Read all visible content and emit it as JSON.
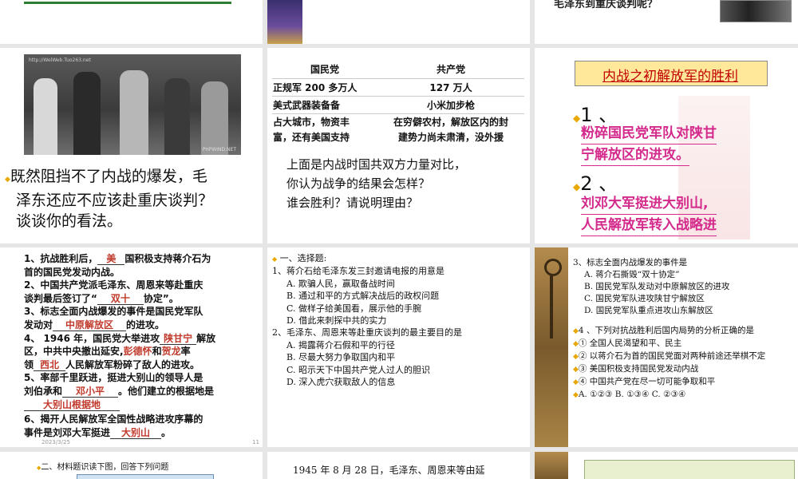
{
  "slide1": {
    "text": "毛泽东到重庆谈判呢？"
  },
  "slide4": {
    "watermark_top": "http://WelWeb.Tuo263.net",
    "watermark_bottom": "PHPWIND.NET",
    "q_line1": "既然阻挡不了内战的爆发，毛",
    "q_line2": "泽东还应不应该赴重庆谈判？",
    "q_line3": "谈谈你的看法。"
  },
  "slide5": {
    "headers": [
      "国民党",
      "共产党"
    ],
    "rows": [
      [
        "正规军 200 多万人",
        "127 万人"
      ],
      [
        "美式武器装备备",
        "小米加步枪"
      ],
      [
        "占大城市，物资丰\n富，还有美国支持",
        "在穷僻农村，解放区内的封\n建势力尚未肃清，没外援"
      ]
    ],
    "q1": "上面是内战时国共双方力量对比，",
    "q2": "你认为战争的结果会怎样？",
    "q3": "谁会胜利？请说明理由？"
  },
  "slide6": {
    "title": "内战之初解放军的胜利",
    "n1": "1 、",
    "t1a": "粉碎国民党军队对陕甘",
    "t1b": "宁解放区的进攻。",
    "n2": "2 、",
    "t2a": "刘邓大军挺进大别山,",
    "t2b": "人民解放军转入战略进"
  },
  "slide7": {
    "l1a": "1、抗战胜利后，",
    "a1": "美",
    "l1b": "国积极支持蒋介石为",
    "l1c": "首的国民党发动内战。",
    "l2a": "2、中国共产党派毛泽东、周恩来等赴重庆",
    "l2b": "谈判最后签订了“",
    "a2": "双十",
    "l2c": "协定”。",
    "l3a": "3、标志全面内战爆发的事件是国民党军队",
    "l3b": "发动对",
    "a3": "中原解放区",
    "l3c": "的进攻。",
    "l4a": "4、 1946 年，国民党大举进攻",
    "a4a": "陕甘宁",
    "l4b": "解放",
    "l4c": "区，中共中央撤出延安,",
    "a4b": "彭德怀",
    "l4d": "和",
    "a4c": "贺龙",
    "l4e": "率",
    "l4f": "领",
    "a4d": "西北",
    "l4g": "人民解放军粉碎了敌人的进攻。",
    "l5a": "5、率部千里跃进，挺进大别山的领导人是",
    "l5b": "刘伯承和",
    "a5a": "邓小平",
    "l5c": "。他们建立的根据地是",
    "a5b": "大别山根据地",
    "l6a": "6、揭开人民解放军全国性战略进攻序幕的",
    "l6b": "事件是刘邓大军挺进",
    "a6": "大别山",
    "l6c": "。",
    "page": "11",
    "date": "2023/3/25"
  },
  "slide8": {
    "head": "一、选择题:",
    "q1": "1、蒋介石给毛泽东发三封邀请电报的用意是",
    "q1opts": [
      "A. 欺骗人民，赢取备战时间",
      "B. 通过和平的方式解决战后的政权问题",
      "C. 做样子给美国看，展示他的手腕",
      "D. 借此来刺探中共的实力"
    ],
    "q2": "2、毛泽东、周恩来等赴重庆谈判的最主要目的是",
    "q2opts": [
      "A. 揭露蒋介石假和平的行径",
      "B. 尽最大努力争取国内和平",
      "C. 昭示天下中国共产党人过人的胆识",
      "D. 深入虎穴获取敌人的信息"
    ]
  },
  "slide9": {
    "q3": "3、标志全面内战爆发的事件是",
    "q3opts": [
      "A. 蒋介石撕毁“双十协定”",
      "B. 国民党军队发动对中原解放区的进攻",
      "C. 国民党军队进攻陕甘宁解放区",
      "D. 国民党军队重点进攻山东解放区"
    ],
    "q4": "4 、下列对抗战胜利后国内局势的分析正确的是",
    "q4opts": [
      "① 全国人民渴望和平、民主",
      "② 以蒋介石为首的国民党面对两种前途还举棋不定",
      "③ 美国积极支持国民党发动内战",
      "④ 中国共产党在尽一切可能争取和平"
    ],
    "q4ans": "A. ①②③   B. ①③④  C. ②③④"
  },
  "slide10": {
    "head": "二、材料题识读下图，回答下列问题"
  },
  "slide11": {
    "text": "1945 年 8 月 28 日，毛泽东、周恩来等由延"
  }
}
